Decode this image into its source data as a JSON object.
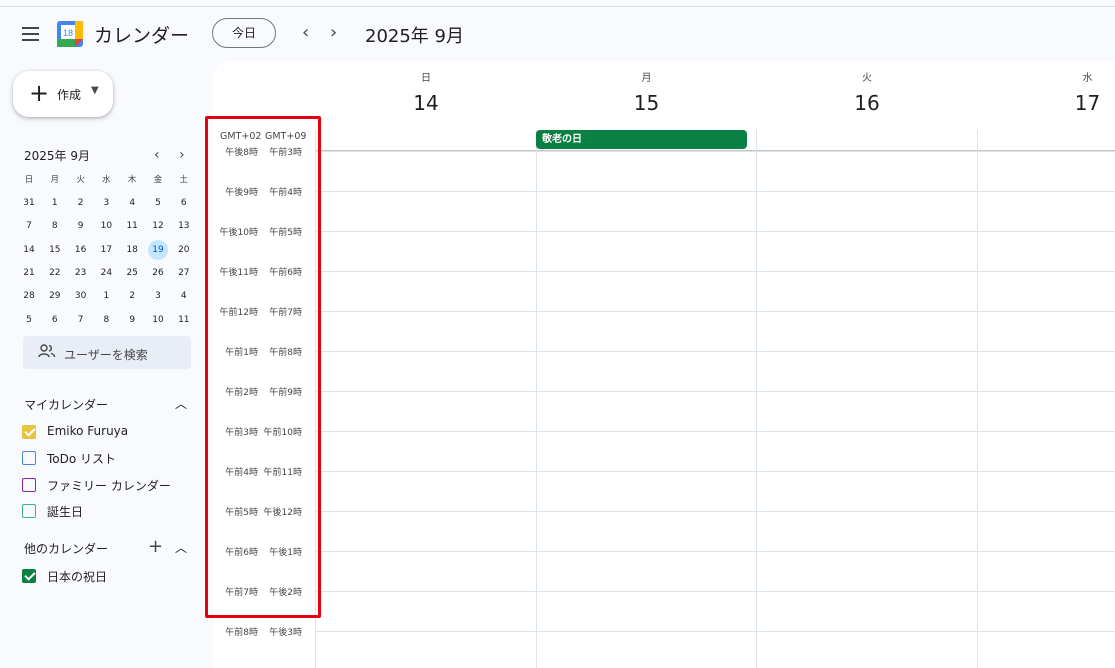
{
  "header": {
    "app_title": "カレンダー",
    "logo_date": "18",
    "today_label": "今日",
    "period": "2025年 9月"
  },
  "sidebar": {
    "create_label": "作成",
    "mini_calendar": {
      "title": "2025年 9月",
      "weekdays": [
        "日",
        "月",
        "火",
        "水",
        "木",
        "金",
        "土"
      ],
      "weeks": [
        [
          "31",
          "1",
          "2",
          "3",
          "4",
          "5",
          "6"
        ],
        [
          "7",
          "8",
          "9",
          "10",
          "11",
          "12",
          "13"
        ],
        [
          "14",
          "15",
          "16",
          "17",
          "18",
          "19",
          "20"
        ],
        [
          "21",
          "22",
          "23",
          "24",
          "25",
          "26",
          "27"
        ],
        [
          "28",
          "29",
          "30",
          "1",
          "2",
          "3",
          "4"
        ],
        [
          "5",
          "6",
          "7",
          "8",
          "9",
          "10",
          "11"
        ]
      ],
      "today": "19"
    },
    "search_people": "ユーザーを検索",
    "my_calendars": {
      "title": "マイカレンダー",
      "items": [
        {
          "label": "Emiko Furuya",
          "color": "#e4c441",
          "checked": true
        },
        {
          "label": "ToDo リスト",
          "color": "#4285f4",
          "checked": false
        },
        {
          "label": "ファミリー カレンダー",
          "color": "#8e24aa",
          "checked": false
        },
        {
          "label": "誕生日",
          "color": "#33b679",
          "checked": false
        }
      ]
    },
    "other_calendars": {
      "title": "他のカレンダー",
      "items": [
        {
          "label": "日本の祝日",
          "color": "#0b8043",
          "checked": true
        }
      ]
    }
  },
  "week": {
    "days": [
      {
        "dow": "日",
        "date": "14"
      },
      {
        "dow": "月",
        "date": "15"
      },
      {
        "dow": "火",
        "date": "16"
      },
      {
        "dow": "水",
        "date": "17"
      }
    ],
    "timezones": [
      "GMT+02",
      "GMT+09"
    ],
    "all_day_events": [
      {
        "title": "敬老の日",
        "day": "15",
        "color": "#0b8043"
      }
    ],
    "time_rows": [
      [
        "午後8時",
        "午前3時"
      ],
      [
        "午後9時",
        "午前4時"
      ],
      [
        "午後10時",
        "午前5時"
      ],
      [
        "午後11時",
        "午前6時"
      ],
      [
        "午前12時",
        "午前7時"
      ],
      [
        "午前1時",
        "午前8時"
      ],
      [
        "午前2時",
        "午前9時"
      ],
      [
        "午前3時",
        "午前10時"
      ],
      [
        "午前4時",
        "午前11時"
      ],
      [
        "午前5時",
        "午後12時"
      ],
      [
        "午前6時",
        "午後1時"
      ],
      [
        "午前7時",
        "午後2時"
      ],
      [
        "午前8時",
        "午後3時"
      ]
    ]
  },
  "annotation": {
    "color": "#e60012"
  }
}
